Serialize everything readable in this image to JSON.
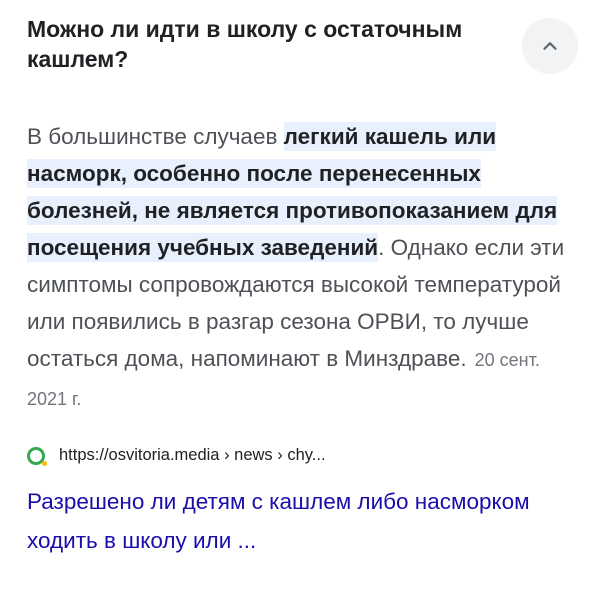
{
  "question": {
    "title": "Можно ли идти в школу с остаточным кашлем?"
  },
  "collapse_button": {
    "icon": "chevron-up-icon"
  },
  "answer": {
    "text_before": "В большинстве случаев ",
    "highlight": "легкий кашель или насморк, особенно после перенесенных болезней, не является противопоказанием для посещения учебных заведений",
    "text_after": ". Однако если эти симптомы сопровождаются высокой температурой или появились в разгар сезона ОРВИ, то лучше остаться дома, напоминают в Минздраве.",
    "date": "20 сент. 2021 г."
  },
  "source": {
    "favicon": "osvitoria-favicon",
    "url": "https://osvitoria.media › news › chy..."
  },
  "result": {
    "title": "Разрешено ли детям с кашлем либо насморком ходить в школу или ..."
  },
  "colors": {
    "highlight_bg": "#e8f0fe",
    "link": "#1a0dab",
    "favicon": "#34a853"
  }
}
